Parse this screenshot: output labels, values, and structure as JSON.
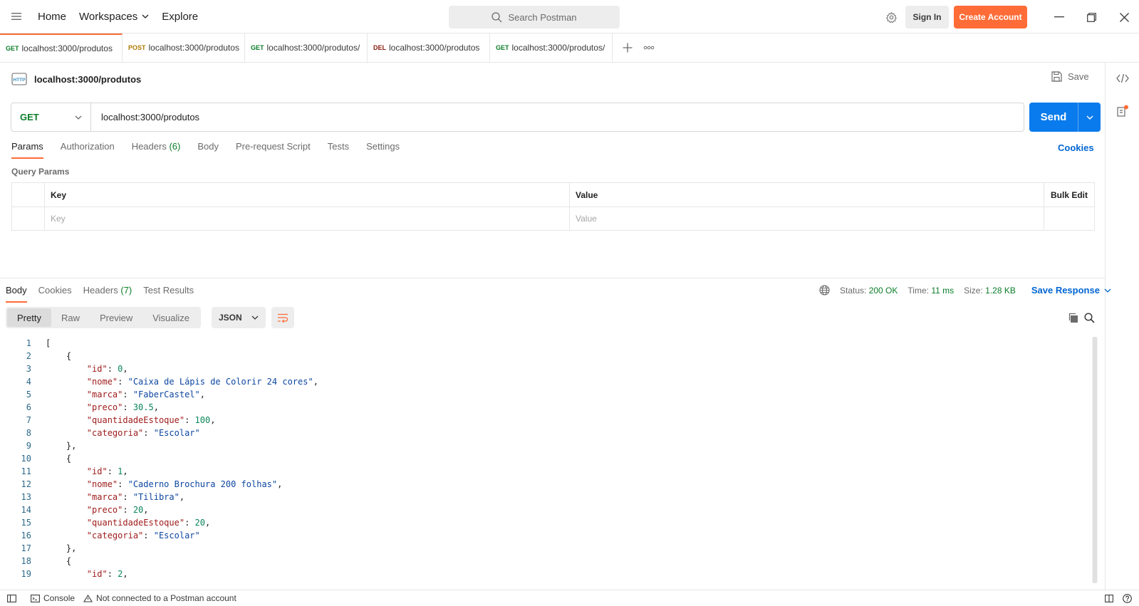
{
  "nav": {
    "home": "Home",
    "workspaces": "Workspaces",
    "explore": "Explore",
    "search_placeholder": "Search Postman",
    "sign_in": "Sign In",
    "create_account": "Create Account"
  },
  "tabs": [
    {
      "method": "GET",
      "url": "localhost:3000/produtos",
      "color": "#0a7d29"
    },
    {
      "method": "POST",
      "url": "localhost:3000/produtos",
      "color": "#ad7a03"
    },
    {
      "method": "GET",
      "url": "localhost:3000/produtos/",
      "color": "#0a7d29"
    },
    {
      "method": "DEL",
      "url": "localhost:3000/produtos",
      "color": "#8e1a10"
    },
    {
      "method": "GET",
      "url": "localhost:3000/produtos/",
      "color": "#0a7d29"
    }
  ],
  "request": {
    "title": "localhost:3000/produtos",
    "save": "Save",
    "method": "GET",
    "url": "localhost:3000/produtos",
    "send": "Send",
    "tabs": {
      "params": "Params",
      "authorization": "Authorization",
      "headers": "Headers",
      "headers_count": "(6)",
      "body": "Body",
      "prerequest": "Pre-request Script",
      "tests": "Tests",
      "settings": "Settings"
    },
    "cookies": "Cookies",
    "query_params_label": "Query Params",
    "table": {
      "key_header": "Key",
      "value_header": "Value",
      "bulk_edit": "Bulk Edit",
      "key_placeholder": "Key",
      "value_placeholder": "Value"
    }
  },
  "response": {
    "tabs": {
      "body": "Body",
      "cookies": "Cookies",
      "headers": "Headers",
      "headers_count": "(7)",
      "test_results": "Test Results"
    },
    "status_label": "Status:",
    "status_value": "200 OK",
    "time_label": "Time:",
    "time_value": "11 ms",
    "size_label": "Size:",
    "size_value": "1.28 KB",
    "save_response": "Save Response",
    "views": [
      "Pretty",
      "Raw",
      "Preview",
      "Visualize"
    ],
    "format": "JSON",
    "lines": [
      {
        "n": "1",
        "tokens": [
          [
            "p",
            "["
          ]
        ]
      },
      {
        "n": "2",
        "tokens": [
          [
            "p",
            "    {"
          ]
        ]
      },
      {
        "n": "3",
        "tokens": [
          [
            "p",
            "        "
          ],
          [
            "k",
            "\"id\""
          ],
          [
            "p",
            ": "
          ],
          [
            "n",
            "0"
          ],
          [
            "p",
            ","
          ]
        ]
      },
      {
        "n": "4",
        "tokens": [
          [
            "p",
            "        "
          ],
          [
            "k",
            "\"nome\""
          ],
          [
            "p",
            ": "
          ],
          [
            "s",
            "\"Caixa de Lápis de Colorir 24 cores\""
          ],
          [
            "p",
            ","
          ]
        ]
      },
      {
        "n": "5",
        "tokens": [
          [
            "p",
            "        "
          ],
          [
            "k",
            "\"marca\""
          ],
          [
            "p",
            ": "
          ],
          [
            "s",
            "\"FaberCastel\""
          ],
          [
            "p",
            ","
          ]
        ]
      },
      {
        "n": "6",
        "tokens": [
          [
            "p",
            "        "
          ],
          [
            "k",
            "\"preco\""
          ],
          [
            "p",
            ": "
          ],
          [
            "n",
            "30.5"
          ],
          [
            "p",
            ","
          ]
        ]
      },
      {
        "n": "7",
        "tokens": [
          [
            "p",
            "        "
          ],
          [
            "k",
            "\"quantidadeEstoque\""
          ],
          [
            "p",
            ": "
          ],
          [
            "n",
            "100"
          ],
          [
            "p",
            ","
          ]
        ]
      },
      {
        "n": "8",
        "tokens": [
          [
            "p",
            "        "
          ],
          [
            "k",
            "\"categoria\""
          ],
          [
            "p",
            ": "
          ],
          [
            "s",
            "\"Escolar\""
          ]
        ]
      },
      {
        "n": "9",
        "tokens": [
          [
            "p",
            "    },"
          ]
        ]
      },
      {
        "n": "10",
        "tokens": [
          [
            "p",
            "    {"
          ]
        ]
      },
      {
        "n": "11",
        "tokens": [
          [
            "p",
            "        "
          ],
          [
            "k",
            "\"id\""
          ],
          [
            "p",
            ": "
          ],
          [
            "n",
            "1"
          ],
          [
            "p",
            ","
          ]
        ]
      },
      {
        "n": "12",
        "tokens": [
          [
            "p",
            "        "
          ],
          [
            "k",
            "\"nome\""
          ],
          [
            "p",
            ": "
          ],
          [
            "s",
            "\"Caderno Brochura 200 folhas\""
          ],
          [
            "p",
            ","
          ]
        ]
      },
      {
        "n": "13",
        "tokens": [
          [
            "p",
            "        "
          ],
          [
            "k",
            "\"marca\""
          ],
          [
            "p",
            ": "
          ],
          [
            "s",
            "\"Tilibra\""
          ],
          [
            "p",
            ","
          ]
        ]
      },
      {
        "n": "14",
        "tokens": [
          [
            "p",
            "        "
          ],
          [
            "k",
            "\"preco\""
          ],
          [
            "p",
            ": "
          ],
          [
            "n",
            "20"
          ],
          [
            "p",
            ","
          ]
        ]
      },
      {
        "n": "15",
        "tokens": [
          [
            "p",
            "        "
          ],
          [
            "k",
            "\"quantidadeEstoque\""
          ],
          [
            "p",
            ": "
          ],
          [
            "n",
            "20"
          ],
          [
            "p",
            ","
          ]
        ]
      },
      {
        "n": "16",
        "tokens": [
          [
            "p",
            "        "
          ],
          [
            "k",
            "\"categoria\""
          ],
          [
            "p",
            ": "
          ],
          [
            "s",
            "\"Escolar\""
          ]
        ]
      },
      {
        "n": "17",
        "tokens": [
          [
            "p",
            "    },"
          ]
        ]
      },
      {
        "n": "18",
        "tokens": [
          [
            "p",
            "    {"
          ]
        ]
      },
      {
        "n": "19",
        "tokens": [
          [
            "p",
            "        "
          ],
          [
            "k",
            "\"id\""
          ],
          [
            "p",
            ": "
          ],
          [
            "n",
            "2"
          ],
          [
            "p",
            ","
          ]
        ]
      }
    ]
  },
  "statusbar": {
    "console": "Console",
    "not_connected": "Not connected to a Postman account"
  },
  "colors": {
    "accent": "#ff6c37",
    "send": "#097bed",
    "get": "#0a7d29",
    "link": "#0265d2"
  }
}
